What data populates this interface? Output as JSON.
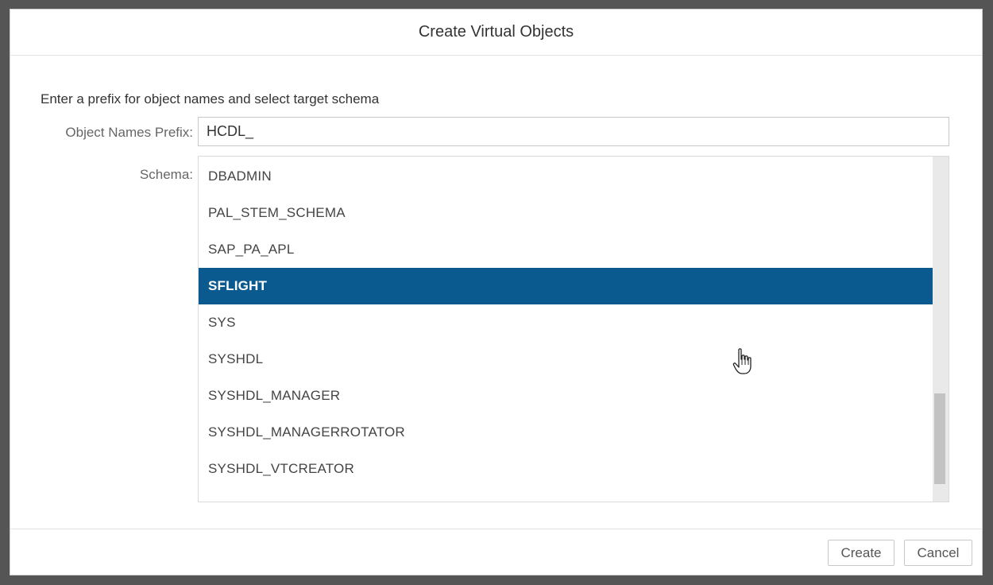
{
  "dialog": {
    "title": "Create Virtual Objects",
    "instruction": "Enter a prefix for object names and select target schema",
    "prefix_label": "Object Names Prefix:",
    "prefix_value": "HCDL_",
    "schema_label": "Schema:",
    "schemas": [
      {
        "name": "DBADMIN",
        "selected": false
      },
      {
        "name": "PAL_STEM_SCHEMA",
        "selected": false
      },
      {
        "name": "SAP_PA_APL",
        "selected": false
      },
      {
        "name": "SFLIGHT",
        "selected": true
      },
      {
        "name": "SYS",
        "selected": false
      },
      {
        "name": "SYSHDL",
        "selected": false
      },
      {
        "name": "SYSHDL_MANAGER",
        "selected": false
      },
      {
        "name": "SYSHDL_MANAGERROTATOR",
        "selected": false
      },
      {
        "name": "SYSHDL_VTCREATOR",
        "selected": false
      }
    ]
  },
  "footer": {
    "create_label": "Create",
    "cancel_label": "Cancel"
  },
  "colors": {
    "selected_bg": "#0b5a8f",
    "selected_text": "#ffffff"
  },
  "icons": {
    "cursor": "hand-pointer-icon"
  }
}
